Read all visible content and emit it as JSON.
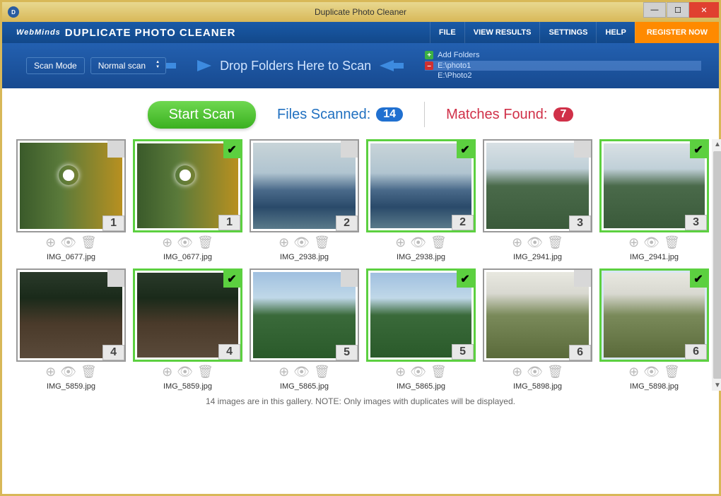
{
  "window": {
    "title": "Duplicate Photo Cleaner"
  },
  "brand": {
    "company": "WebMinds",
    "app": "DUPLICATE PHOTO CLEANER"
  },
  "menu": {
    "file": "FILE",
    "view": "VIEW RESULTS",
    "settings": "SETTINGS",
    "help": "HELP",
    "register": "REGISTER NOW"
  },
  "scanbar": {
    "mode_label": "Scan Mode",
    "mode_value": "Normal scan",
    "drop_text": "Drop Folders Here to Scan",
    "add_folders": "Add Folders",
    "folders": [
      "E:\\photo1",
      "E:\\Photo2"
    ]
  },
  "stats": {
    "start": "Start Scan",
    "scanned_label": "Files Scanned:",
    "scanned_value": "14",
    "matches_label": "Matches Found:",
    "matches_value": "7"
  },
  "thumbs": [
    {
      "name": "IMG_0677.jpg",
      "group": "1",
      "checked": false,
      "theme": "th-dandelion"
    },
    {
      "name": "IMG_0677.jpg",
      "group": "1",
      "checked": true,
      "theme": "th-dandelion"
    },
    {
      "name": "IMG_2938.jpg",
      "group": "2",
      "checked": false,
      "theme": "th-mountains"
    },
    {
      "name": "IMG_2938.jpg",
      "group": "2",
      "checked": true,
      "theme": "th-mountains"
    },
    {
      "name": "IMG_2941.jpg",
      "group": "3",
      "checked": false,
      "theme": "th-hills"
    },
    {
      "name": "IMG_2941.jpg",
      "group": "3",
      "checked": true,
      "theme": "th-hills"
    },
    {
      "name": "IMG_5859.jpg",
      "group": "4",
      "checked": false,
      "theme": "th-forest"
    },
    {
      "name": "IMG_5859.jpg",
      "group": "4",
      "checked": true,
      "theme": "th-forest"
    },
    {
      "name": "IMG_5865.jpg",
      "group": "5",
      "checked": false,
      "theme": "th-meadow"
    },
    {
      "name": "IMG_5865.jpg",
      "group": "5",
      "checked": true,
      "theme": "th-meadow"
    },
    {
      "name": "IMG_5898.jpg",
      "group": "6",
      "checked": false,
      "theme": "th-slope"
    },
    {
      "name": "IMG_5898.jpg",
      "group": "6",
      "checked": true,
      "theme": "th-slope",
      "row_sel": true
    }
  ],
  "footer": "14 images are in this gallery. NOTE: Only images with duplicates will be displayed."
}
